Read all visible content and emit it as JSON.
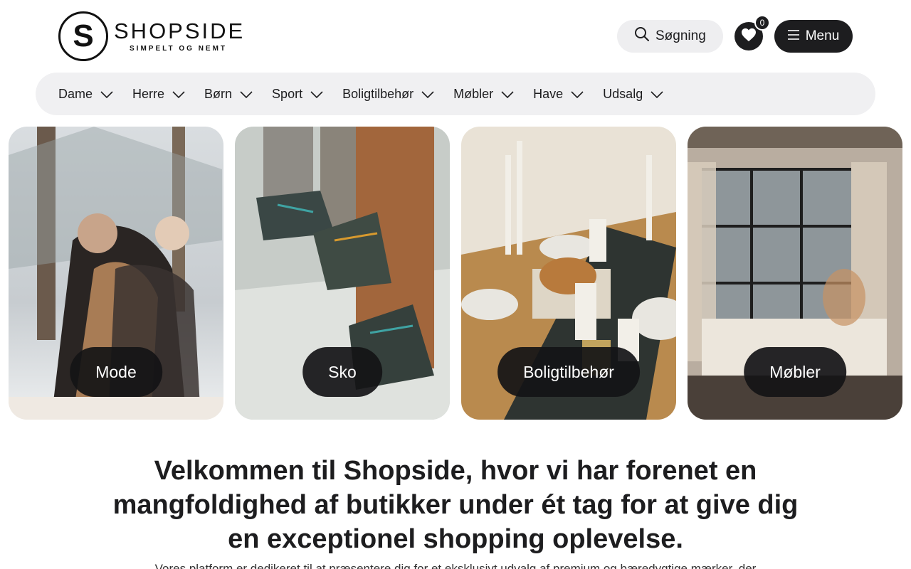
{
  "brand": {
    "logo_letter": "S",
    "name": "SHOPSIDE",
    "tagline": "SIMPELT OG NEMT"
  },
  "header": {
    "search_label": "Søgning",
    "favorites_count": "0",
    "menu_label": "Menu"
  },
  "nav": {
    "items": [
      {
        "label": "Dame"
      },
      {
        "label": "Herre"
      },
      {
        "label": "Børn"
      },
      {
        "label": "Sport"
      },
      {
        "label": "Boligtilbehør"
      },
      {
        "label": "Møbler"
      },
      {
        "label": "Have"
      },
      {
        "label": "Udsalg"
      }
    ]
  },
  "categories": [
    {
      "label": "Mode"
    },
    {
      "label": "Sko"
    },
    {
      "label": "Boligtilbehør"
    },
    {
      "label": "Møbler"
    }
  ],
  "welcome": {
    "heading": "Velkommen til Shopside, hvor vi har forenet en mangfoldighed af butikker under ét tag for at give dig en exceptionel shopping oplevelse.",
    "intro": "Vores platform er dedikeret til at præsentere dig for et eksklusivt udvalg af premium og bæredygtige mærker, der"
  }
}
